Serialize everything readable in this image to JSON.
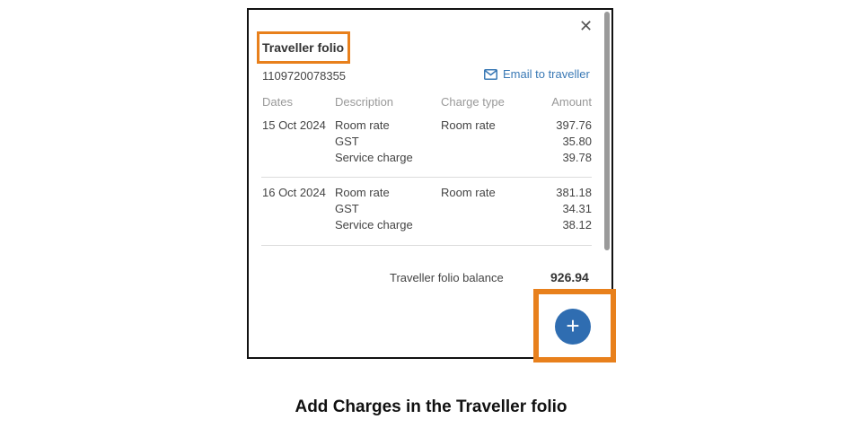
{
  "panel": {
    "close_symbol": "✕",
    "title": "Traveller folio",
    "folio_number": "1109720078355",
    "email_link": "Email to traveller",
    "headers": {
      "dates": "Dates",
      "description": "Description",
      "charge_type": "Charge type",
      "amount": "Amount"
    },
    "groups": [
      {
        "date": "15 Oct 2024",
        "charge_type": "Room rate",
        "lines": [
          {
            "description": "Room rate",
            "amount": "397.76"
          },
          {
            "description": "GST",
            "amount": "35.80"
          },
          {
            "description": "Service charge",
            "amount": "39.78"
          }
        ]
      },
      {
        "date": "16 Oct 2024",
        "charge_type": "Room rate",
        "lines": [
          {
            "description": "Room rate",
            "amount": "381.18"
          },
          {
            "description": "GST",
            "amount": "34.31"
          },
          {
            "description": "Service charge",
            "amount": "38.12"
          }
        ]
      }
    ],
    "balance_label": "Traveller folio balance",
    "balance_value": "926.94",
    "add_symbol": "+"
  },
  "caption": "Add Charges in the Traveller folio",
  "colors": {
    "highlight": "#e8801c",
    "accent": "#2f6db1",
    "link": "#3a79b5"
  },
  "icons": [
    "close-icon",
    "mail-icon",
    "plus-icon"
  ]
}
